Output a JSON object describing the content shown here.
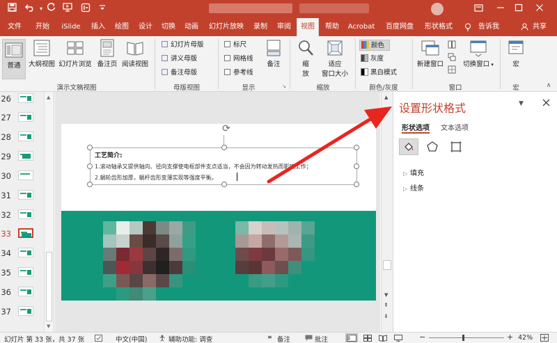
{
  "titlebar": {
    "qa_icons": [
      "save-icon",
      "undo-icon",
      "redo-icon",
      "present-icon",
      "islide-icon",
      "more-icon"
    ],
    "window_buttons": [
      "ribbon-display-icon",
      "minimize-icon",
      "restore-icon",
      "close-icon"
    ]
  },
  "tabs": [
    "文件",
    "开始",
    "iSlide",
    "插入",
    "绘图",
    "设计",
    "切换",
    "动画",
    "幻灯片放映",
    "录制",
    "审阅",
    "视图",
    "帮助",
    "Acrobat",
    "百度网盘",
    "形状格式",
    "告诉我",
    "共享"
  ],
  "active_tab": "视图",
  "ribbon": {
    "views": {
      "normal": "普通",
      "outline": "大纲视图",
      "sorter": "幻灯片浏览",
      "notes_page": "备注页",
      "reading": "阅读视图",
      "group_label": "演示文稿视图"
    },
    "master": {
      "slide_master": "幻灯片母版",
      "handout_master": "讲义母版",
      "notes_master": "备注母版",
      "group_label": "母版视图"
    },
    "show": {
      "ruler": "标尺",
      "gridlines": "网格线",
      "guides": "参考线",
      "notes": "备注",
      "group_label": "显示"
    },
    "zoom": {
      "zoom_a": "缩",
      "zoom_b": "放",
      "fit_a": "适应",
      "fit_b": "窗口大小",
      "group_label": "缩放"
    },
    "color": {
      "color": "颜色",
      "grayscale": "灰度",
      "bw": "黑白模式",
      "group_label": "颜色/灰度"
    },
    "window": {
      "new_window": "新建窗口",
      "switch_window": "切换窗口",
      "group_label": "窗口"
    },
    "macros": {
      "macros": "宏",
      "group_label": "宏"
    }
  },
  "thumbnails": {
    "numbers": [
      "26",
      "27",
      "28",
      "29",
      "30",
      "31",
      "32",
      "33",
      "34",
      "35",
      "36",
      "37"
    ],
    "selected": "33"
  },
  "slide": {
    "textbox": {
      "title": "工艺简介:",
      "line1": "1.滚动轴承又提供轴向、径向支撑使电枢部件支点适当，不会因为转动发热而影响工作；",
      "line2": "2.蜗轮齿形加厚，蜗杆齿形变薄实现等强度平衡。"
    }
  },
  "format_pane": {
    "title": "设置形状格式",
    "tab_shape": "形状选项",
    "tab_text": "文本选项",
    "sections": [
      "填充",
      "线条"
    ]
  },
  "status": {
    "slide_info": "幻灯片 第 33 张，共 37 张",
    "language": "中文(中国)",
    "accessibility": "辅助功能: 调查",
    "notes": "备注",
    "comments": "批注",
    "zoom": "42%"
  },
  "colors": {
    "accent": "#c2412d",
    "teal": "#12977a"
  }
}
